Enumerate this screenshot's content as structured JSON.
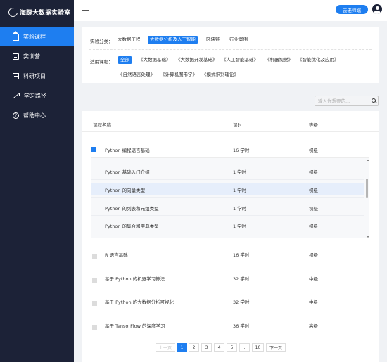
{
  "app": {
    "title": "海豚大数据实验室"
  },
  "sidebar": {
    "items": [
      {
        "label": "实验课程",
        "icon": "home-icon",
        "active": true
      },
      {
        "label": "实训营",
        "icon": "training-icon",
        "active": false
      },
      {
        "label": "科研项目",
        "icon": "research-icon",
        "active": false
      },
      {
        "label": "学习路径",
        "icon": "path-icon",
        "active": false
      },
      {
        "label": "帮助中心",
        "icon": "help-icon",
        "active": false
      }
    ]
  },
  "header": {
    "teacher_button": "去老师端",
    "help_glyph": "?"
  },
  "filters": {
    "category_label": "实验分类：",
    "categories": [
      "大数据工程",
      "大数据分析及人工智能",
      "区块链",
      "行业案例"
    ],
    "category_selected": 1,
    "course_label": "适用课程：",
    "courses": [
      "全部",
      "《大数据基础》",
      "《大数据开发基础》",
      "《人工智能基础》",
      "《机器视觉》",
      "《智能优化及应用》",
      "《自然语言处理》",
      "《计算机图形学》",
      "《模式识别理论》"
    ],
    "course_selected": 0
  },
  "search": {
    "placeholder": "输入你想要的..."
  },
  "table": {
    "headers": {
      "name": "课程名称",
      "hours": "课时",
      "level": "等级"
    },
    "expanded": {
      "name": "Python 编程语言基础",
      "hours": "16 学时",
      "level": "初级",
      "checked": true
    },
    "sub_rows": [
      {
        "name": "Python 基础入门介绍",
        "hours": "1 学时",
        "level": "初级"
      },
      {
        "name": "Python 的向量类型",
        "hours": "1 学时",
        "level": "初级",
        "highlighted": true
      },
      {
        "name": "Python 的列表和元组类型",
        "hours": "1 学时",
        "level": "初级"
      },
      {
        "name": "Python 的集合和字典类型",
        "hours": "1 学时",
        "level": "初级"
      }
    ],
    "rows": [
      {
        "name": "R 语言基础",
        "hours": "16 学时",
        "level": "初级"
      },
      {
        "name": "基于 Python 的机器学习算法",
        "hours": "32 学时",
        "level": "中级"
      },
      {
        "name": "基于 Python 的大数据分析可视化",
        "hours": "32 学时",
        "level": "中级"
      },
      {
        "name": "基于 TensorFlow 的深度学习",
        "hours": "36 学时",
        "level": "高级"
      }
    ]
  },
  "pagination": {
    "prev": "上一页",
    "pages": [
      "1",
      "2",
      "3",
      "4",
      "5",
      "...",
      "10"
    ],
    "current": "1",
    "next": "下一页"
  },
  "colors": {
    "accent": "#1e7ef0",
    "sidebar_bg": "#1c2237",
    "page_bg": "#f0f2f5"
  }
}
